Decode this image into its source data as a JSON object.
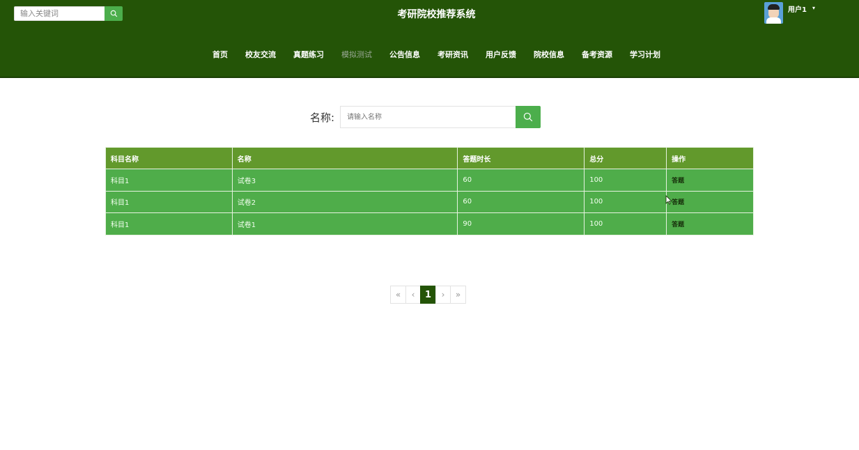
{
  "header": {
    "search_placeholder": "输入关键词",
    "title": "考研院校推荐系统",
    "user_name": "用户1",
    "caret": "▾",
    "nav": [
      "首页",
      "校友交流",
      "真题练习",
      "模拟测试",
      "公告信息",
      "考研资讯",
      "用户反馈",
      "院校信息",
      "备考资源",
      "学习计划"
    ],
    "active_nav": "模拟测试"
  },
  "search": {
    "label": "名称:",
    "placeholder": "请输入名称"
  },
  "table": {
    "columns": [
      "科目名称",
      "名称",
      "答题时长",
      "总分",
      "操作"
    ],
    "rows": [
      [
        "科目1",
        "试卷3",
        "60",
        "100",
        "答题"
      ],
      [
        "科目1",
        "试卷2",
        "60",
        "100",
        "答题"
      ],
      [
        "科目1",
        "试卷1",
        "90",
        "100",
        "答题"
      ]
    ]
  },
  "pagination": {
    "first": "«",
    "prev": "‹",
    "current": "1",
    "next": "›",
    "last": "»"
  },
  "colors": {
    "header_bg": "#245407",
    "accent": "#4cae4c",
    "table_header": "#62992c",
    "table_row": "#4fad4a"
  }
}
